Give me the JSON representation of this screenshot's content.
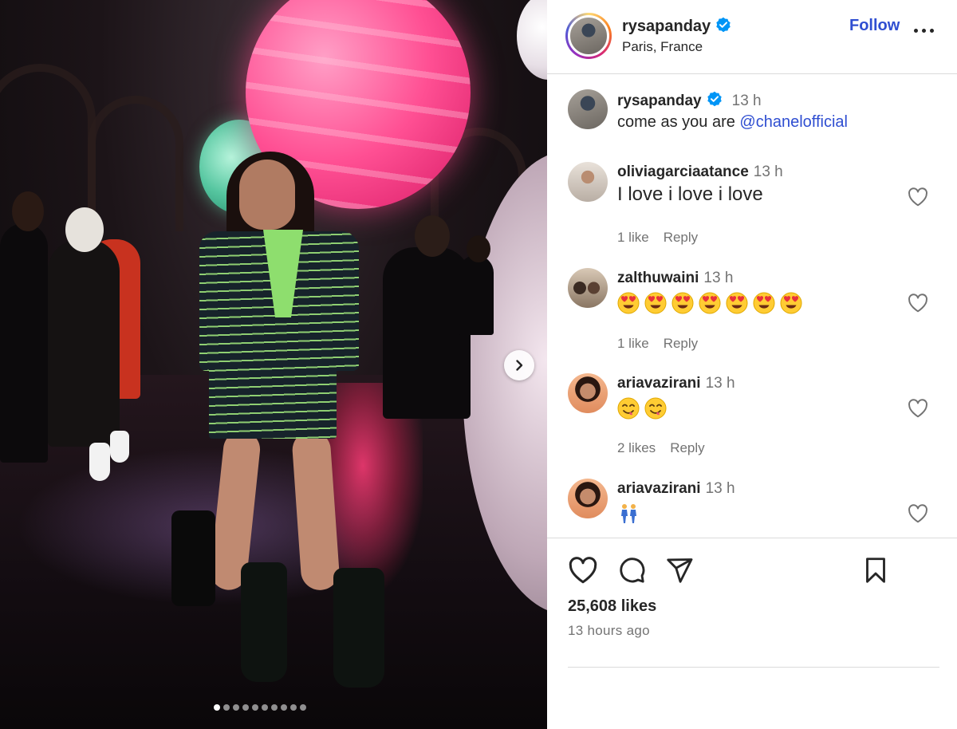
{
  "post": {
    "author": "rysapanday",
    "location": "Paris, France",
    "follow_label": "Follow",
    "carousel": {
      "slide_count": 10,
      "active_index": 0
    }
  },
  "caption": {
    "username": "rysapanday",
    "time": "13 h",
    "text": "come as you are",
    "mention": "@chanelofficial"
  },
  "comments": [
    {
      "username": "oliviagarciaatance",
      "time": "13 h",
      "text": "I love i love i love",
      "likes": "1 like",
      "reply": "Reply"
    },
    {
      "username": "zalthuwaini",
      "time": "13 h",
      "emojis": [
        "heart-eyes",
        "heart-eyes",
        "heart-eyes",
        "heart-eyes",
        "heart-eyes",
        "heart-eyes",
        "heart-eyes"
      ],
      "likes": "1 like",
      "reply": "Reply"
    },
    {
      "username": "ariavazirani",
      "time": "13 h",
      "emojis": [
        "yum",
        "yum"
      ],
      "likes": "2 likes",
      "reply": "Reply"
    },
    {
      "username": "ariavazirani",
      "time": "13 h",
      "emojis": [
        "people-walking"
      ],
      "likes": "",
      "reply": ""
    }
  ],
  "stats": {
    "likes": "25,608 likes",
    "posted": "13 hours ago"
  },
  "icons": [
    "verified-badge-icon",
    "more-options-icon",
    "heart-icon",
    "comment-icon",
    "share-icon",
    "bookmark-icon",
    "chevron-right-icon"
  ],
  "colors": {
    "link": "#2f4ed1",
    "verified": "#0095f6",
    "muted": "#737373",
    "text": "#262626"
  }
}
